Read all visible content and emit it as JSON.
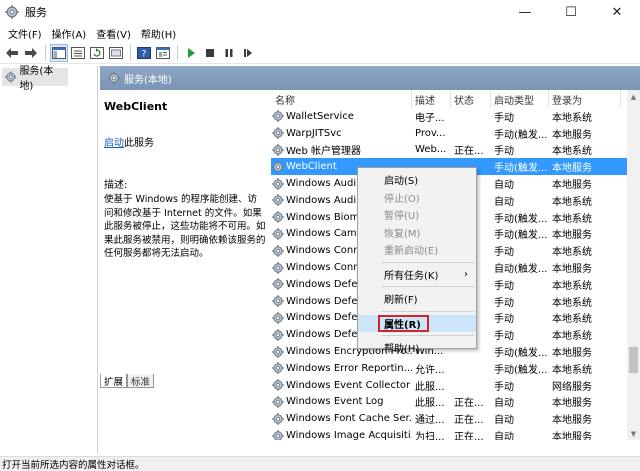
{
  "window": {
    "title": "服务",
    "minimize": "—",
    "maximize": "☐",
    "close": "✕"
  },
  "menu": [
    "文件(F)",
    "操作(A)",
    "查看(V)",
    "帮助(H)"
  ],
  "tree": {
    "root_label": "服务(本地)"
  },
  "content_header": "服务(本地)",
  "details": {
    "service_title": "WebClient",
    "start_link": "启动",
    "start_suffix": "此服务",
    "desc_label": "描述:",
    "desc_text": "使基于 Windows 的程序能创建、访问和修改基于 Internet 的文件。如果此服务被停止，这些功能将不可用。如果此服务被禁用，则明确依赖该服务的任何服务都将无法启动。"
  },
  "columns": [
    "名称",
    "描述",
    "状态",
    "启动类型",
    "登录为"
  ],
  "rows": [
    {
      "name": "WalletService",
      "desc": "电子...",
      "status": "",
      "start": "手动",
      "logon": "本地系统"
    },
    {
      "name": "WarpJITSvc",
      "desc": "Prov...",
      "status": "",
      "start": "手动(触发...",
      "logon": "本地服务"
    },
    {
      "name": "Web 帐户管理器",
      "desc": "Web...",
      "status": "正在...",
      "start": "手动",
      "logon": "本地系统"
    },
    {
      "name": "WebClient",
      "desc": "",
      "status": "",
      "start": "手动(触发...",
      "logon": "本地服务"
    },
    {
      "name": "Windows Audi",
      "desc": "",
      "status": "",
      "start": "自动",
      "logon": "本地服务"
    },
    {
      "name": "Windows Audi",
      "desc": "",
      "status": "",
      "start": "自动",
      "logon": "本地系统"
    },
    {
      "name": "Windows Biom",
      "desc": "",
      "status": "",
      "start": "手动(触发...",
      "logon": "本地系统"
    },
    {
      "name": "Windows Cam",
      "desc": "",
      "status": "",
      "start": "手动(触发...",
      "logon": "本地服务"
    },
    {
      "name": "Windows Conr",
      "desc": "",
      "status": "",
      "start": "手动",
      "logon": "本地系统"
    },
    {
      "name": "Windows Conr",
      "desc": "",
      "status": "",
      "start": "自动(触发...",
      "logon": "本地服务"
    },
    {
      "name": "Windows Defe",
      "desc": "",
      "status": "",
      "start": "手动",
      "logon": "本地系统"
    },
    {
      "name": "Windows Defe",
      "desc": "",
      "status": "",
      "start": "手动",
      "logon": "本地系统"
    },
    {
      "name": "Windows Defe",
      "desc": "",
      "status": "",
      "start": "手动",
      "logon": "本地系统"
    },
    {
      "name": "Windows Defe",
      "desc": "",
      "status": "",
      "start": "手动",
      "logon": "本地系统"
    },
    {
      "name": "Windows Encryption Pro...",
      "desc": "Win...",
      "status": "",
      "start": "手动(触发...",
      "logon": "本地服务"
    },
    {
      "name": "Windows Error Reportin...",
      "desc": "允许...",
      "status": "",
      "start": "手动(触发...",
      "logon": "本地系统"
    },
    {
      "name": "Windows Event Collector",
      "desc": "此服...",
      "status": "",
      "start": "手动",
      "logon": "网络服务"
    },
    {
      "name": "Windows Event Log",
      "desc": "此服...",
      "status": "正在...",
      "start": "自动",
      "logon": "本地服务"
    },
    {
      "name": "Windows Font Cache Ser...",
      "desc": "通过...",
      "status": "正在...",
      "start": "自动",
      "logon": "本地服务"
    },
    {
      "name": "Windows Image Acquisiti...",
      "desc": "为扫...",
      "status": "正在...",
      "start": "自动",
      "logon": "本地服务"
    }
  ],
  "context_menu": {
    "start": "启动(S)",
    "stop": "停止(O)",
    "pause": "暂停(U)",
    "resume": "恢复(M)",
    "restart": "重新启动(E)",
    "all_tasks": "所有任务(K)",
    "refresh": "刷新(F)",
    "properties": "属性(R)",
    "help": "帮助(H)"
  },
  "bottom_tabs": [
    "扩展",
    "标准"
  ],
  "status_bar": "打开当前所选内容的属性对话框。",
  "colors": {
    "selection": "#3399ff",
    "header": "#7f99b8",
    "highlight_box": "#d0252e",
    "link": "#1b5fb8"
  }
}
